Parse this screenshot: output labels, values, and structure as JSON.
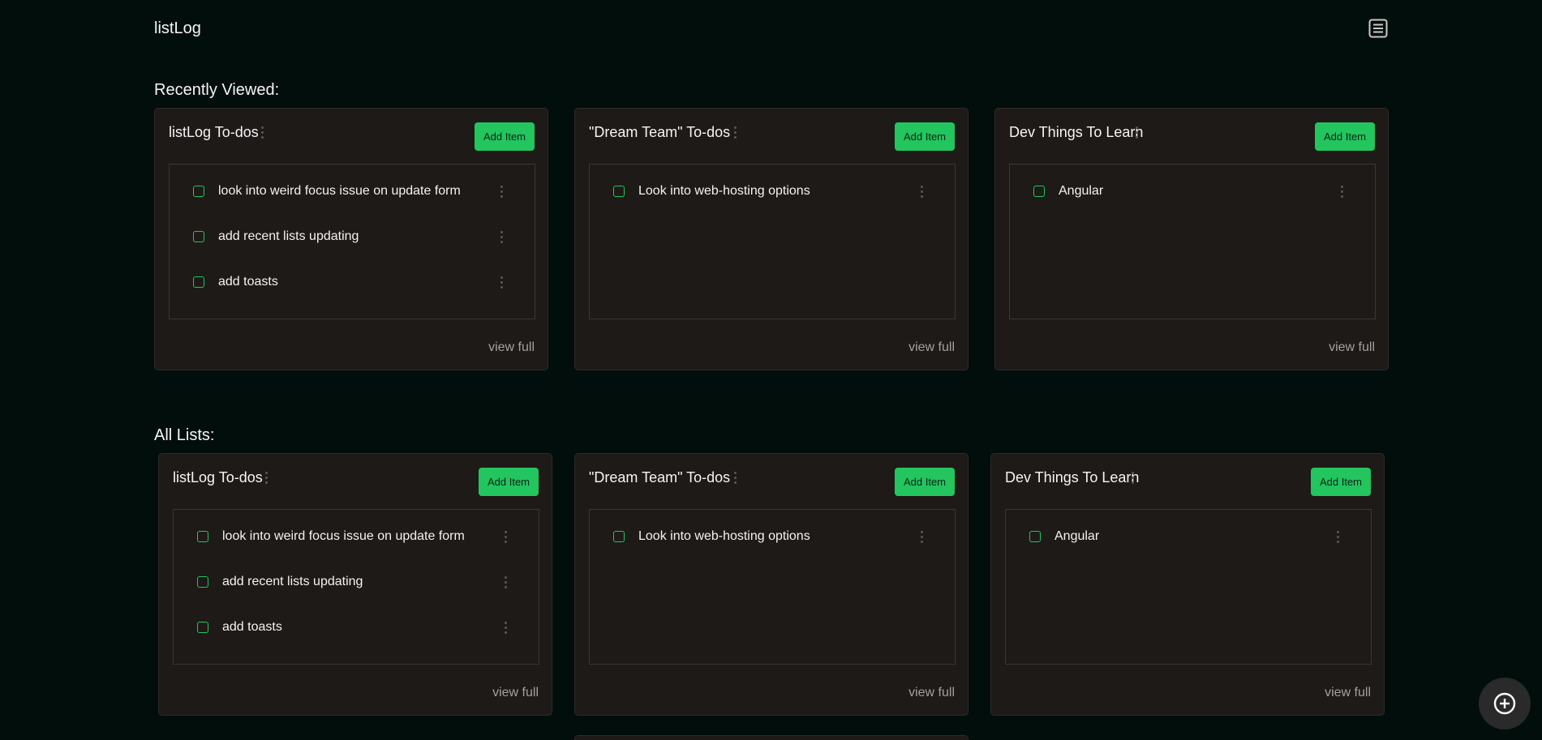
{
  "app": {
    "title": "listLog",
    "menu_icon": "list-menu-icon",
    "fab_icon": "plus-circle-icon"
  },
  "colors": {
    "background": "#020e0c",
    "card": "#1e1a18",
    "accent": "#22c55e"
  },
  "sections": {
    "recent": {
      "title": "Recently Viewed:",
      "lists": [
        {
          "title": "listLog To-dos",
          "add_label": "Add Item",
          "view_label": "view full",
          "items": [
            "look into weird focus issue on update form",
            "add recent lists updating",
            "add toasts"
          ]
        },
        {
          "title": "\"Dream Team\" To-dos",
          "add_label": "Add Item",
          "view_label": "view full",
          "items": [
            "Look into web-hosting options"
          ]
        },
        {
          "title": "Dev Things To Learn",
          "add_label": "Add Item",
          "view_label": "view full",
          "items": [
            "Angular"
          ]
        }
      ]
    },
    "all": {
      "title": "All Lists:",
      "lists": [
        {
          "title": "listLog To-dos",
          "add_label": "Add Item",
          "view_label": "view full",
          "items": [
            "look into weird focus issue on update form",
            "add recent lists updating",
            "add toasts"
          ]
        },
        {
          "title": "\"Dream Team\" To-dos",
          "add_label": "Add Item",
          "view_label": "view full",
          "items": [
            "Look into web-hosting options"
          ]
        },
        {
          "title": "Dev Things To Learn",
          "add_label": "Add Item",
          "view_label": "view full",
          "items": [
            "Angular"
          ]
        }
      ]
    }
  }
}
